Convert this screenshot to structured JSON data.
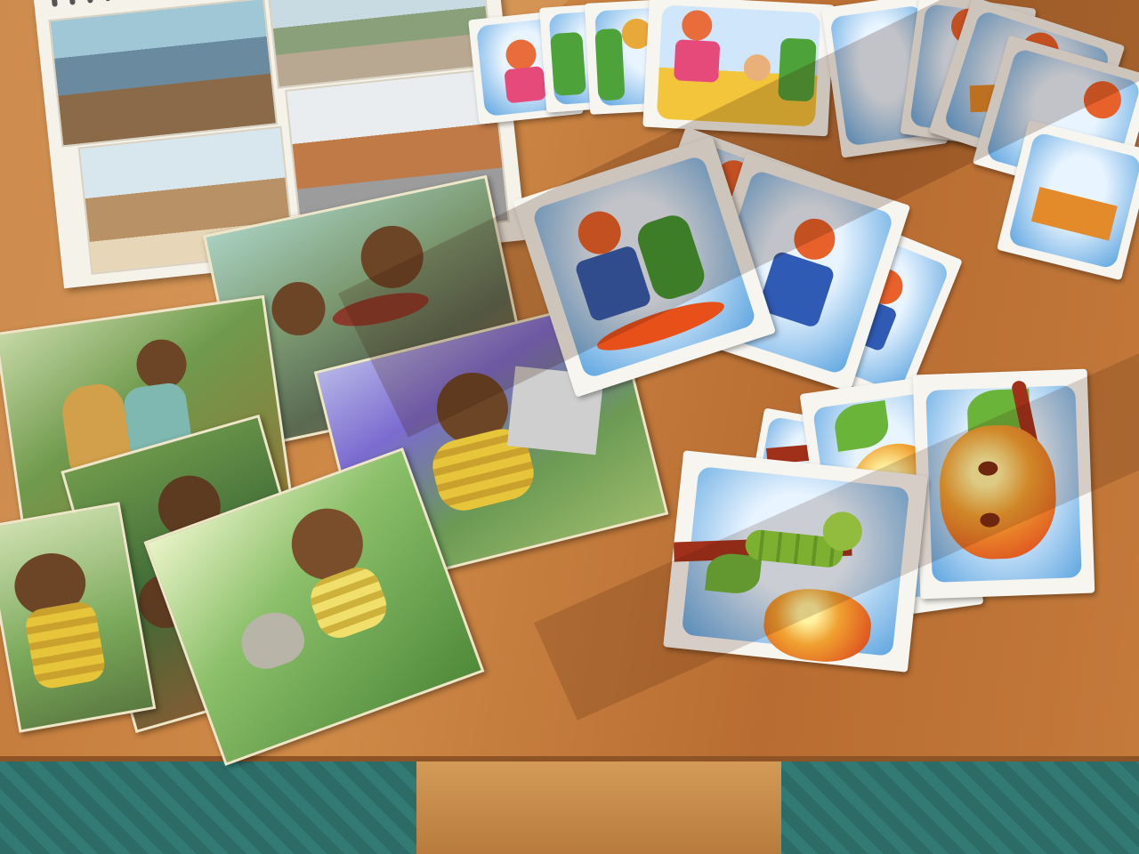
{
  "scene": {
    "subject": "",
    "colors": {
      "table": "#c47a3b",
      "carpet": "#2f6f6a",
      "card_border": "#f6f5f0",
      "sky": "#5ea5e0",
      "apple": "#e84a2a",
      "caterpillar": "#8bd13a",
      "bear_fur": "#6b4526",
      "lavender": "#7b6bd0",
      "grass": "#4f9a3a"
    },
    "icons": [
      "spiral-binding",
      "bear-illustration",
      "girl-illustration",
      "apple-illustration",
      "caterpillar-illustration",
      "hedgehog-illustration"
    ]
  }
}
